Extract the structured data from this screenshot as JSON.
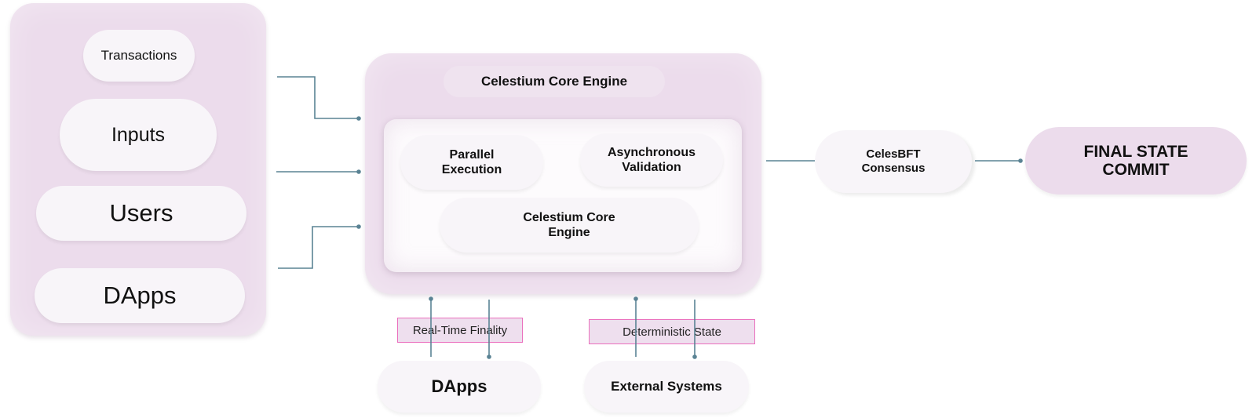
{
  "diagram": {
    "inputs_group": {
      "items": [
        {
          "label": "Transactions"
        },
        {
          "label": "Inputs"
        },
        {
          "label": "Users"
        },
        {
          "label": "DApps"
        }
      ]
    },
    "core": {
      "title": "Celestium Core Engine",
      "modules": [
        {
          "label": "Parallel Execution"
        },
        {
          "label": "Asynchronous Validation"
        },
        {
          "label": "Celestium Core Engine"
        }
      ]
    },
    "consensus": {
      "label": "CelesBFT Consensus"
    },
    "final": {
      "label": "FINAL STATE COMMIT"
    },
    "bottom": {
      "links": [
        {
          "label": "Real-Time Finality"
        },
        {
          "label": "Deterministic State"
        }
      ],
      "nodes": [
        {
          "label": "DApps"
        },
        {
          "label": "External Systems"
        }
      ]
    },
    "colors": {
      "panel": "#ecdcec",
      "pill": "#f8f5f9",
      "connector": "#5a8394",
      "label_border": "#ea6fbd"
    }
  }
}
